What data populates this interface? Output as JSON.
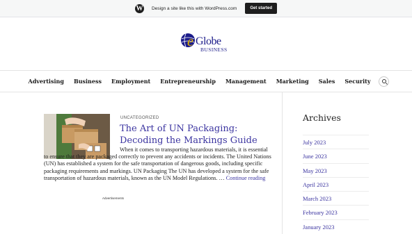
{
  "promo_bar": {
    "text": "Design a site like this with WordPress.com",
    "button_label": "Get started",
    "logo_glyph": "W"
  },
  "site": {
    "logo_word": "Globe",
    "logo_sub": "BUSINESS",
    "brand_colors": {
      "blue": "#1c1c8a",
      "gold": "#e0b400",
      "link": "#3b34a0"
    }
  },
  "nav": {
    "items": [
      "Advertising",
      "Business",
      "Employment",
      "Entrepreneurship",
      "Management",
      "Marketing",
      "Sales",
      "Security"
    ],
    "search_icon": "search-icon"
  },
  "post": {
    "category": "UNCATEGORIZED",
    "title": "The Art of UN Packaging: Decoding the Markings Guide",
    "excerpt": "When it comes to transporting hazardous materials, it is essential to ensure that they are packaged correctly to prevent any accidents or incidents. The United Nations (UN) has established a system for the safe transportation of dangerous goods, including specific packaging requirements and markings. UN Packaging The UN has developed a system for the safe transportation of hazardous materials, known as the UN Model Regulations. … ",
    "continue_label": "Continue reading",
    "ads_label": "Advertisements"
  },
  "sidebar": {
    "archives_title": "Archives",
    "archives": [
      "July 2023",
      "June 2023",
      "May 2023",
      "April 2023",
      "March 2023",
      "February 2023",
      "January 2023"
    ]
  }
}
